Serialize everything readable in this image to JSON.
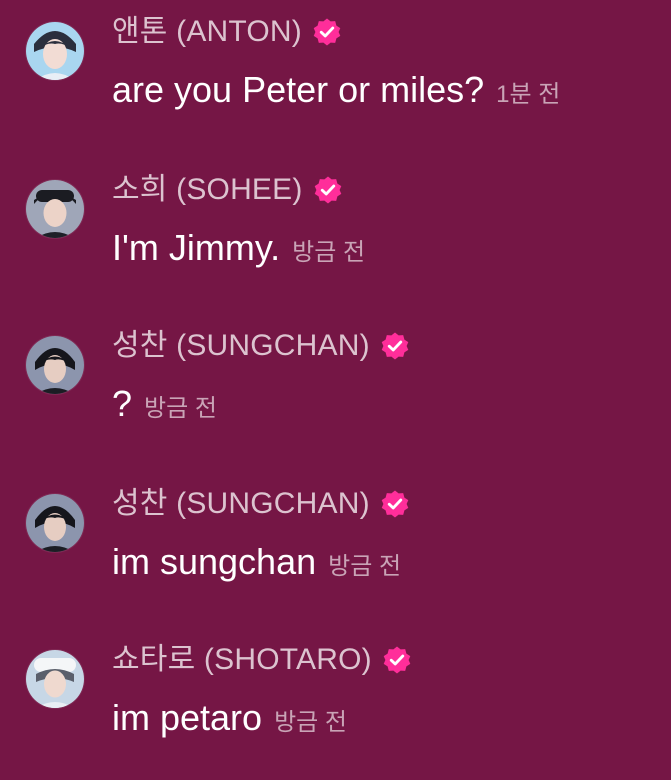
{
  "colors": {
    "background": "#751645",
    "name_text": "#dcc3cf",
    "message_text": "#ffffff",
    "time_text": "#c9a4b6",
    "verified_badge": "#ff2e9a"
  },
  "messages": [
    {
      "name": "앤톤 (ANTON)",
      "text": "are you Peter or miles?",
      "time": "1분 전",
      "verified_icon": "verified-check-icon"
    },
    {
      "name": "소희 (SOHEE)",
      "text": "I'm Jimmy.",
      "time": "방금 전",
      "verified_icon": "verified-check-icon"
    },
    {
      "name": "성찬 (SUNGCHAN)",
      "text": "?",
      "time": "방금 전",
      "verified_icon": "verified-check-icon"
    },
    {
      "name": "성찬 (SUNGCHAN)",
      "text": "im sungchan",
      "time": "방금 전",
      "verified_icon": "verified-check-icon"
    },
    {
      "name": "쇼타로 (SHOTARO)",
      "text": "im petaro",
      "time": "방금 전",
      "verified_icon": "verified-check-icon"
    }
  ]
}
